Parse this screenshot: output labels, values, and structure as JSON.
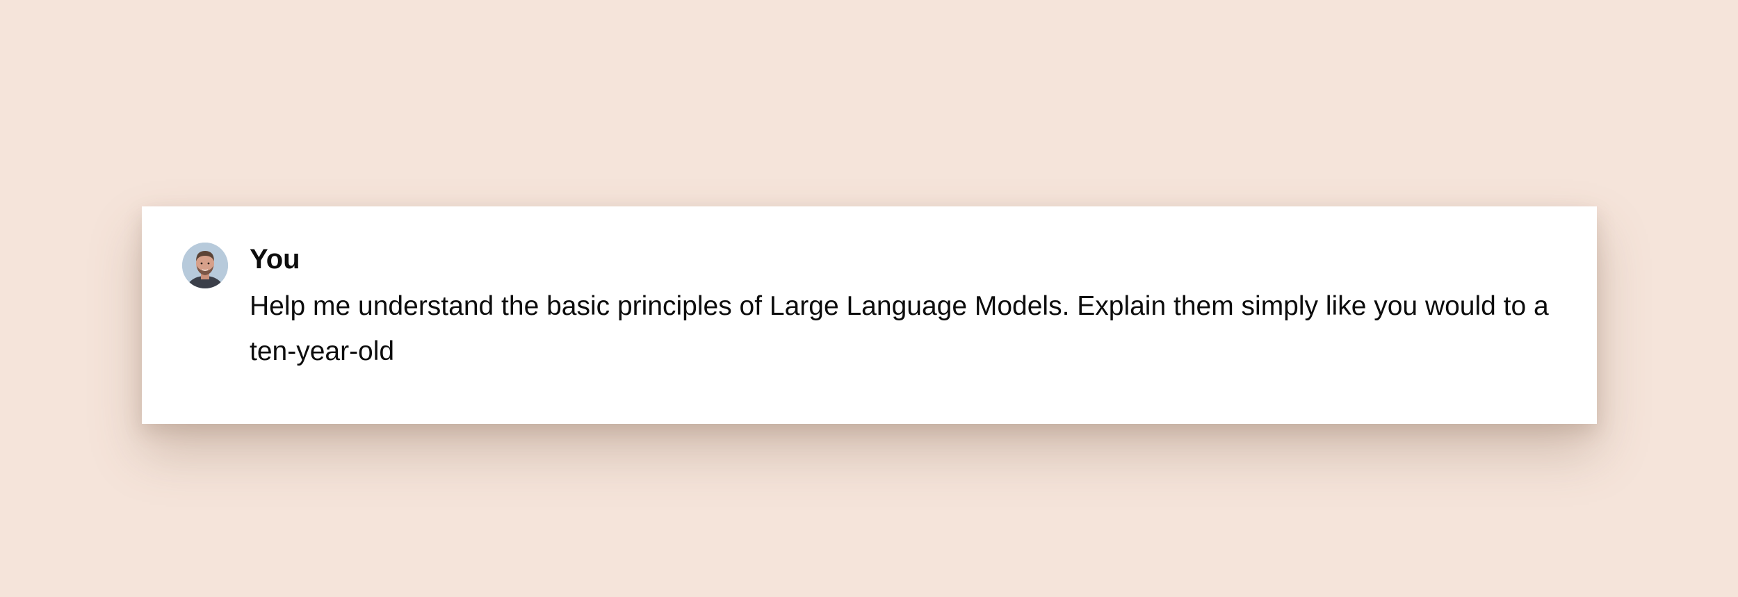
{
  "conversation": {
    "message": {
      "author": "You",
      "avatar_icon": "user-avatar-photo",
      "text": "Help me understand the basic principles of Large Language Models. Explain them simply like you would to a ten-year-old"
    }
  },
  "colors": {
    "background": "#f5e4da",
    "card": "#ffffff",
    "text": "#0d0d0d"
  }
}
